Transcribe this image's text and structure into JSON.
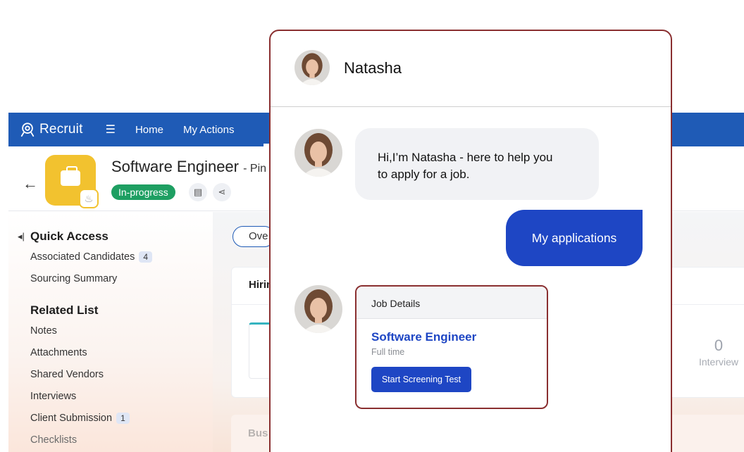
{
  "app": {
    "brand": "Recruit",
    "nav": [
      "Home",
      "My Actions"
    ],
    "record": {
      "title": "Software Engineer",
      "subtitle": "- Pin",
      "status": "In-progress"
    },
    "quick_access": {
      "heading": "Quick Access",
      "items": [
        {
          "label": "Associated Candidates",
          "count": "4"
        },
        {
          "label": "Sourcing Summary"
        }
      ]
    },
    "related_list": {
      "heading": "Related List",
      "items": [
        {
          "label": "Notes"
        },
        {
          "label": "Attachments"
        },
        {
          "label": "Shared Vendors"
        },
        {
          "label": "Interviews"
        },
        {
          "label": "Client Submission",
          "count": "1"
        },
        {
          "label": "Checklists"
        }
      ]
    },
    "main": {
      "tab": "Ove",
      "card_title": "Hirin",
      "stat": {
        "value": "0",
        "label": "Interview"
      },
      "card2_title": "Bus"
    }
  },
  "chat": {
    "agent_name": "Natasha",
    "bot_message_line1": "Hi,I’m Natasha  -  here to help you",
    "bot_message_line2": "to apply for a job.",
    "user_message": "My applications",
    "job_card": {
      "header": "Job Details",
      "title": "Software Engineer",
      "type": "Full time",
      "button": "Start Screening Test"
    }
  },
  "colors": {
    "topbar": "#1f5bb6",
    "status_green": "#1e9f62",
    "chat_blue": "#1e46c4",
    "chat_border": "#8a2f30",
    "job_icon_yellow": "#f2c22f"
  },
  "icons": [
    "recruit-logo-icon",
    "hamburger-menu-icon",
    "back-arrow-icon",
    "briefcase-icon",
    "flame-icon",
    "notes-icon",
    "share-icon",
    "collapse-caret-icon"
  ]
}
